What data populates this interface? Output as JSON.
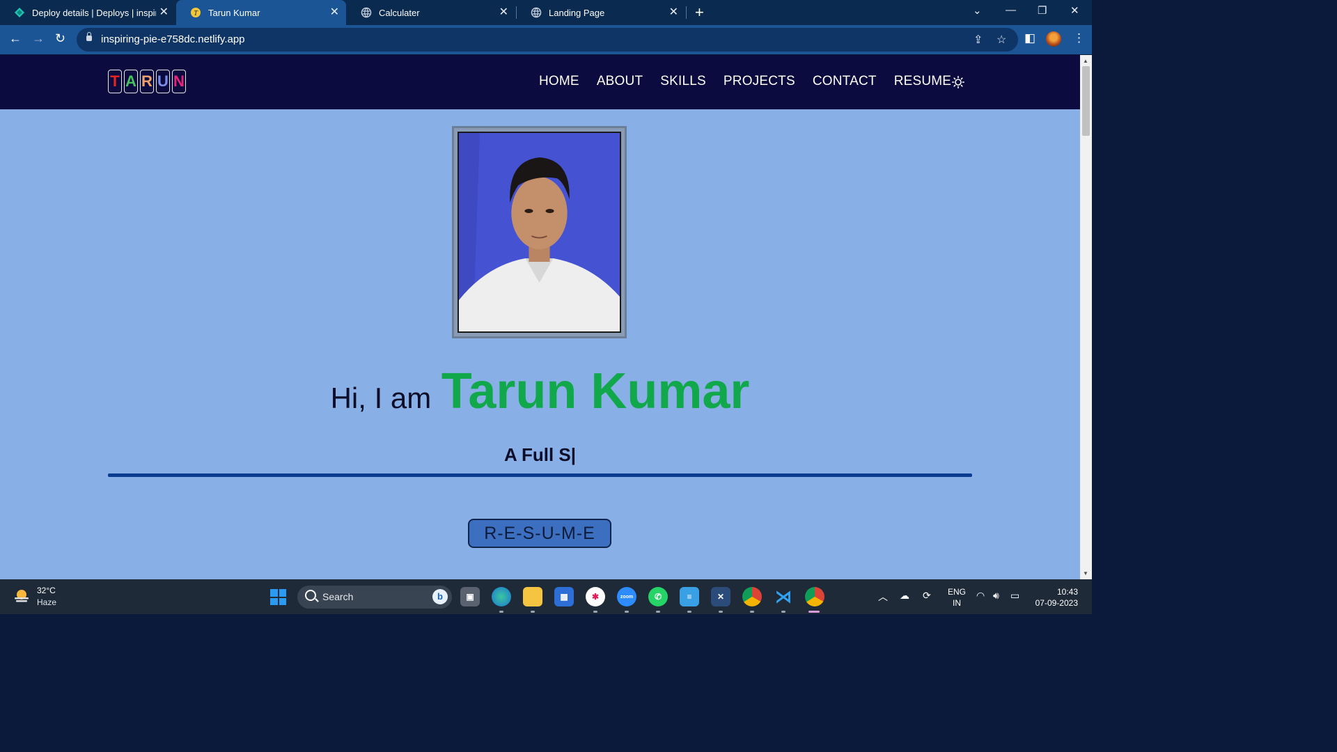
{
  "browser": {
    "tabs": [
      {
        "title": "Deploy details | Deploys | inspiring",
        "active": false
      },
      {
        "title": "Tarun Kumar",
        "active": true
      },
      {
        "title": "Calculater",
        "active": false
      },
      {
        "title": "Landing Page",
        "active": false
      }
    ],
    "url": "inspiring-pie-e758dc.netlify.app"
  },
  "site": {
    "logo_letters": [
      {
        "char": "T",
        "color": "#e8241f"
      },
      {
        "char": "A",
        "color": "#46c25c"
      },
      {
        "char": "R",
        "color": "#f0a06a"
      },
      {
        "char": "U",
        "color": "#7a8ee8"
      },
      {
        "char": "N",
        "color": "#e8247a"
      }
    ],
    "nav": [
      "HOME",
      "ABOUT",
      "SKILLS",
      "PROJECTS",
      "CONTACT",
      "RESUME"
    ],
    "theme_toggle_icon": "sun-icon",
    "hero": {
      "greeting": "Hi, I am",
      "name": "Tarun Kumar",
      "typed_text": "A Full S|",
      "resume_button": "R-E-S-U-M-E"
    },
    "colors": {
      "page_bg": "#89b0e6",
      "nav_bg": "#0b0b3f",
      "name_green": "#10a84a",
      "divider": "#0a3d8f"
    }
  },
  "taskbar": {
    "weather_temp": "32°C",
    "weather_desc": "Haze",
    "search_label": "Search",
    "lang_line1": "ENG",
    "lang_line2": "IN",
    "time": "10:43",
    "date": "07-09-2023"
  }
}
